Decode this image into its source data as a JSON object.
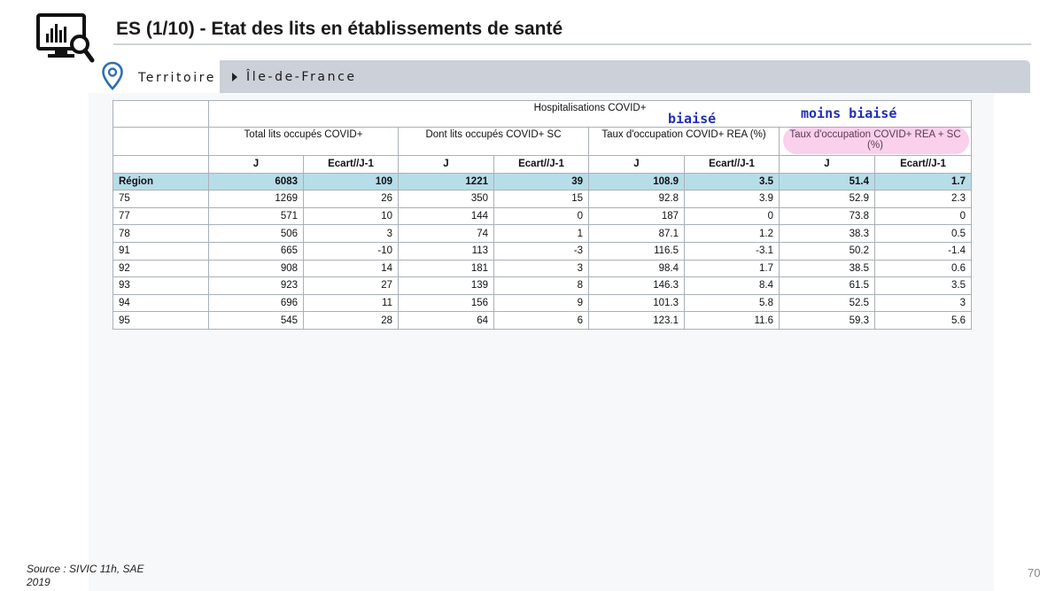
{
  "header": {
    "title": "ES (1/10) - Etat des lits en établissements de santé",
    "icon": "dashboard-search-icon"
  },
  "filter": {
    "label": "Territoire",
    "value": "Île-de-France",
    "icon": "location-pin-icon",
    "accent_color": "#2f6fae"
  },
  "table": {
    "super_header": "Hospitalisations COVID+",
    "groups": [
      "Total lits occupés COVID+",
      "Dont lits occupés COVID+ SC",
      "Taux d'occupation COVID+ REA (%)",
      "Taux d'occupation COVID+ REA + SC (%)"
    ],
    "sub_headers": [
      "J",
      "Ecart//J-1",
      "J",
      "Ecart//J-1",
      "J",
      "Ecart//J-1",
      "J",
      "Ecart//J-1"
    ],
    "rows": [
      {
        "label": "Région",
        "values": [
          "6083",
          "109",
          "1221",
          "39",
          "108.9",
          "3.5",
          "51.4",
          "1.7"
        ]
      },
      {
        "label": "75",
        "values": [
          "1269",
          "26",
          "350",
          "15",
          "92.8",
          "3.9",
          "52.9",
          "2.3"
        ]
      },
      {
        "label": "77",
        "values": [
          "571",
          "10",
          "144",
          "0",
          "187",
          "0",
          "73.8",
          "0"
        ]
      },
      {
        "label": "78",
        "values": [
          "506",
          "3",
          "74",
          "1",
          "87.1",
          "1.2",
          "38.3",
          "0.5"
        ]
      },
      {
        "label": "91",
        "values": [
          "665",
          "-10",
          "113",
          "-3",
          "116.5",
          "-3.1",
          "50.2",
          "-1.4"
        ]
      },
      {
        "label": "92",
        "values": [
          "908",
          "14",
          "181",
          "3",
          "98.4",
          "1.7",
          "38.5",
          "0.6"
        ]
      },
      {
        "label": "93",
        "values": [
          "923",
          "27",
          "139",
          "8",
          "146.3",
          "8.4",
          "61.5",
          "3.5"
        ]
      },
      {
        "label": "94",
        "values": [
          "696",
          "11",
          "156",
          "9",
          "101.3",
          "5.8",
          "52.5",
          "3"
        ]
      },
      {
        "label": "95",
        "values": [
          "545",
          "28",
          "64",
          "6",
          "123.1",
          "11.6",
          "59.3",
          "5.6"
        ]
      }
    ],
    "region_row_color": "#b7dde8"
  },
  "annotations": {
    "biased": "biaisé",
    "less_biased": "moins biaisé",
    "ink_color": "#1f2fb8",
    "highlight_color": "#f078c8"
  },
  "footer": {
    "source": "Source : SIVIC 11h, SAE 2019",
    "page_number": "70"
  }
}
